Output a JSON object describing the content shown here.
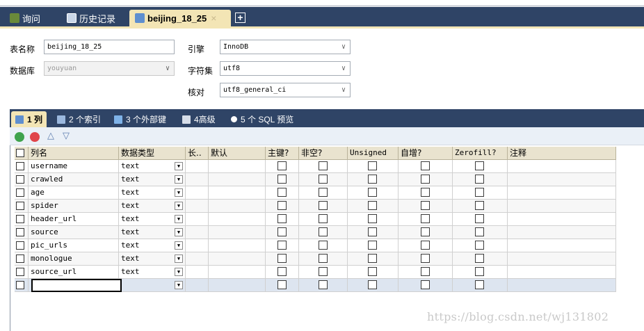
{
  "tabs": [
    {
      "label": "询问",
      "icon": "query-icon"
    },
    {
      "label": "历史记录",
      "icon": "history-icon"
    },
    {
      "label": "beijing_18_25",
      "icon": "table-icon",
      "close": "×"
    }
  ],
  "add_tab": "+",
  "form": {
    "table_name_label": "表名称",
    "table_name_value": "beijing_18_25",
    "database_label": "数据库",
    "database_value": "youyuan",
    "engine_label": "引擎",
    "engine_value": "InnoDB",
    "charset_label": "字符集",
    "charset_value": "utf8",
    "collation_label": "核对",
    "collation_value": "utf8_general_ci"
  },
  "subtabs": [
    {
      "label": "1 列",
      "active": true
    },
    {
      "label": "2 个索引"
    },
    {
      "label": "3 个外部键"
    },
    {
      "label": "4高级"
    },
    {
      "label": "5 个 SQL 预览"
    }
  ],
  "grid": {
    "headers": [
      "列名",
      "数据类型",
      "长..",
      "默认",
      "主键?",
      "非空?",
      "Unsigned",
      "自增?",
      "Zerofill?",
      "注释"
    ],
    "rows": [
      {
        "name": "username",
        "type": "text"
      },
      {
        "name": "crawled",
        "type": "text"
      },
      {
        "name": "age",
        "type": "text"
      },
      {
        "name": "spider",
        "type": "text"
      },
      {
        "name": "header_url",
        "type": "text"
      },
      {
        "name": "source",
        "type": "text"
      },
      {
        "name": "pic_urls",
        "type": "text"
      },
      {
        "name": "monologue",
        "type": "text"
      },
      {
        "name": "source_url",
        "type": "text"
      },
      {
        "name": "",
        "type": ""
      }
    ]
  },
  "watermark": "https://blog.csdn.net/wj131802",
  "colors": {
    "tabbar": "#2f4466",
    "active_tab": "#f3e5b5",
    "header": "#e9e3cf"
  }
}
